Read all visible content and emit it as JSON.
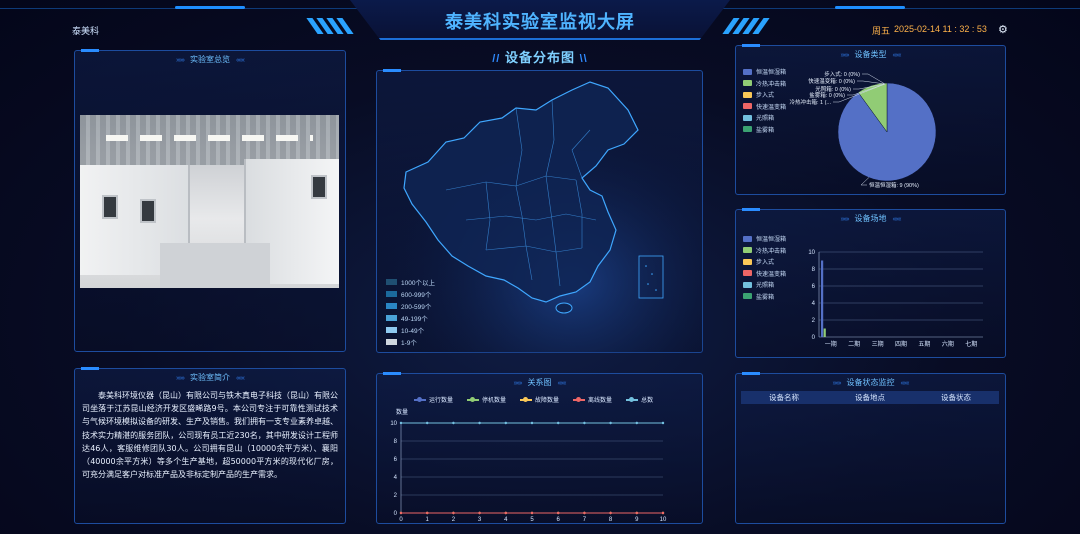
{
  "header": {
    "title": "泰美科实验室监视大屏",
    "brand": "泰美科",
    "weekday": "周五",
    "datetime": "2025-02-14 11 : 32 : 53"
  },
  "panels": {
    "overview_title": "实验室总览",
    "intro_title": "实验室简介",
    "map_title": "设备分布图",
    "type_title": "设备类型",
    "site_title": "设备场地",
    "relation_title": "关系图",
    "status_title": "设备状态监控"
  },
  "intro_text": "泰美科环境仪器（昆山）有限公司与铁木真电子科技（昆山）有限公司坐落于江苏昆山经济开发区盛晞路9号。本公司专注于可靠性测试技术与气候环境模拟设备的研发、生产及销售。我们拥有一支专业素养卓越、技术实力精湛的服务团队，公司现有员工近230名，其中研发设计工程师达46人，客服维修团队30人。公司拥有昆山（10000余平方米）、襄阳（40000余平方米）等多个生产基地，超50000平方米的现代化厂房，可充分满足客户对标准产品及非标定制产品的生产需求。",
  "map_legend": [
    {
      "label": "1000个以上",
      "color": "#1f4f72"
    },
    {
      "label": "600-999个",
      "color": "#1b6a9c"
    },
    {
      "label": "200-599个",
      "color": "#2a86c4"
    },
    {
      "label": "49-199个",
      "color": "#4aa3d8"
    },
    {
      "label": "10-49个",
      "color": "#8fcaf0"
    },
    {
      "label": "1-9个",
      "color": "#cfd6de"
    }
  ],
  "device_types": [
    {
      "label": "恒温恒湿箱",
      "color": "#5470c6"
    },
    {
      "label": "冷热冲击箱",
      "color": "#91cc75"
    },
    {
      "label": "步入式",
      "color": "#fac858"
    },
    {
      "label": "快速温变箱",
      "color": "#ee6666"
    },
    {
      "label": "光照箱",
      "color": "#73c0de"
    },
    {
      "label": "盐雾箱",
      "color": "#3ba272"
    }
  ],
  "status_table": {
    "headers": [
      "设备名称",
      "设备地点",
      "设备状态"
    ]
  },
  "relation_legend": [
    {
      "label": "运行数量",
      "color": "#5470c6"
    },
    {
      "label": "停机数量",
      "color": "#91cc75"
    },
    {
      "label": "故障数量",
      "color": "#fac858"
    },
    {
      "label": "离线数量",
      "color": "#ee6666"
    },
    {
      "label": "总数",
      "color": "#73c0de"
    }
  ],
  "chart_data": [
    {
      "type": "pie",
      "title": "设备类型",
      "slices": [
        {
          "name": "恒温恒湿箱",
          "value": 9,
          "label": "恒温恒湿箱: 9 (90%)",
          "color": "#5470c6"
        },
        {
          "name": "冷热冲击箱",
          "value": 1,
          "label": "冷热冲击箱: 1 (...",
          "color": "#91cc75"
        },
        {
          "name": "步入式",
          "value": 0,
          "label": "步入式: 0 (0%)",
          "color": "#fac858"
        },
        {
          "name": "快速温变箱",
          "value": 0,
          "label": "快速温变箱: 0 (0%)",
          "color": "#ee6666"
        },
        {
          "name": "光照箱",
          "value": 0,
          "label": "光照箱: 0 (0%)",
          "color": "#73c0de"
        },
        {
          "name": "盐雾箱",
          "value": 0,
          "label": "盐雾箱: 0 (0%)",
          "color": "#3ba272"
        }
      ]
    },
    {
      "type": "bar",
      "title": "设备场地",
      "categories": [
        "一期",
        "二期",
        "三期",
        "四期",
        "五期",
        "六期",
        "七期"
      ],
      "ylim": [
        0,
        10
      ],
      "yticks": [
        0,
        2,
        4,
        6,
        8,
        10
      ],
      "series": [
        {
          "name": "恒温恒湿箱",
          "color": "#5470c6",
          "values": [
            9,
            0,
            0,
            0,
            0,
            0,
            0
          ]
        },
        {
          "name": "冷热冲击箱",
          "color": "#91cc75",
          "values": [
            1,
            0,
            0,
            0,
            0,
            0,
            0
          ]
        },
        {
          "name": "步入式",
          "color": "#fac858",
          "values": [
            0,
            0,
            0,
            0,
            0,
            0,
            0
          ]
        },
        {
          "name": "快速温变箱",
          "color": "#ee6666",
          "values": [
            0,
            0,
            0,
            0,
            0,
            0,
            0
          ]
        },
        {
          "name": "光照箱",
          "color": "#73c0de",
          "values": [
            0,
            0,
            0,
            0,
            0,
            0,
            0
          ]
        },
        {
          "name": "盐雾箱",
          "color": "#3ba272",
          "values": [
            0,
            0,
            0,
            0,
            0,
            0,
            0
          ]
        }
      ]
    },
    {
      "type": "line",
      "title": "关系图",
      "ylabel": "数量",
      "x": [
        0,
        1,
        2,
        3,
        4,
        5,
        6,
        7,
        8,
        9,
        10
      ],
      "ylim": [
        0,
        10
      ],
      "yticks": [
        0,
        2,
        4,
        6,
        8,
        10
      ],
      "series": [
        {
          "name": "运行数量",
          "color": "#5470c6",
          "values": [
            10,
            10,
            10,
            10,
            10,
            10,
            10,
            10,
            10,
            10,
            10
          ]
        },
        {
          "name": "停机数量",
          "color": "#91cc75",
          "values": [
            0,
            0,
            0,
            0,
            0,
            0,
            0,
            0,
            0,
            0,
            0
          ]
        },
        {
          "name": "故障数量",
          "color": "#fac858",
          "values": [
            0,
            0,
            0,
            0,
            0,
            0,
            0,
            0,
            0,
            0,
            0
          ]
        },
        {
          "name": "离线数量",
          "color": "#ee6666",
          "values": [
            0,
            0,
            0,
            0,
            0,
            0,
            0,
            0,
            0,
            0,
            0
          ]
        },
        {
          "name": "总数",
          "color": "#73c0de",
          "values": [
            10,
            10,
            10,
            10,
            10,
            10,
            10,
            10,
            10,
            10,
            10
          ]
        }
      ]
    }
  ]
}
